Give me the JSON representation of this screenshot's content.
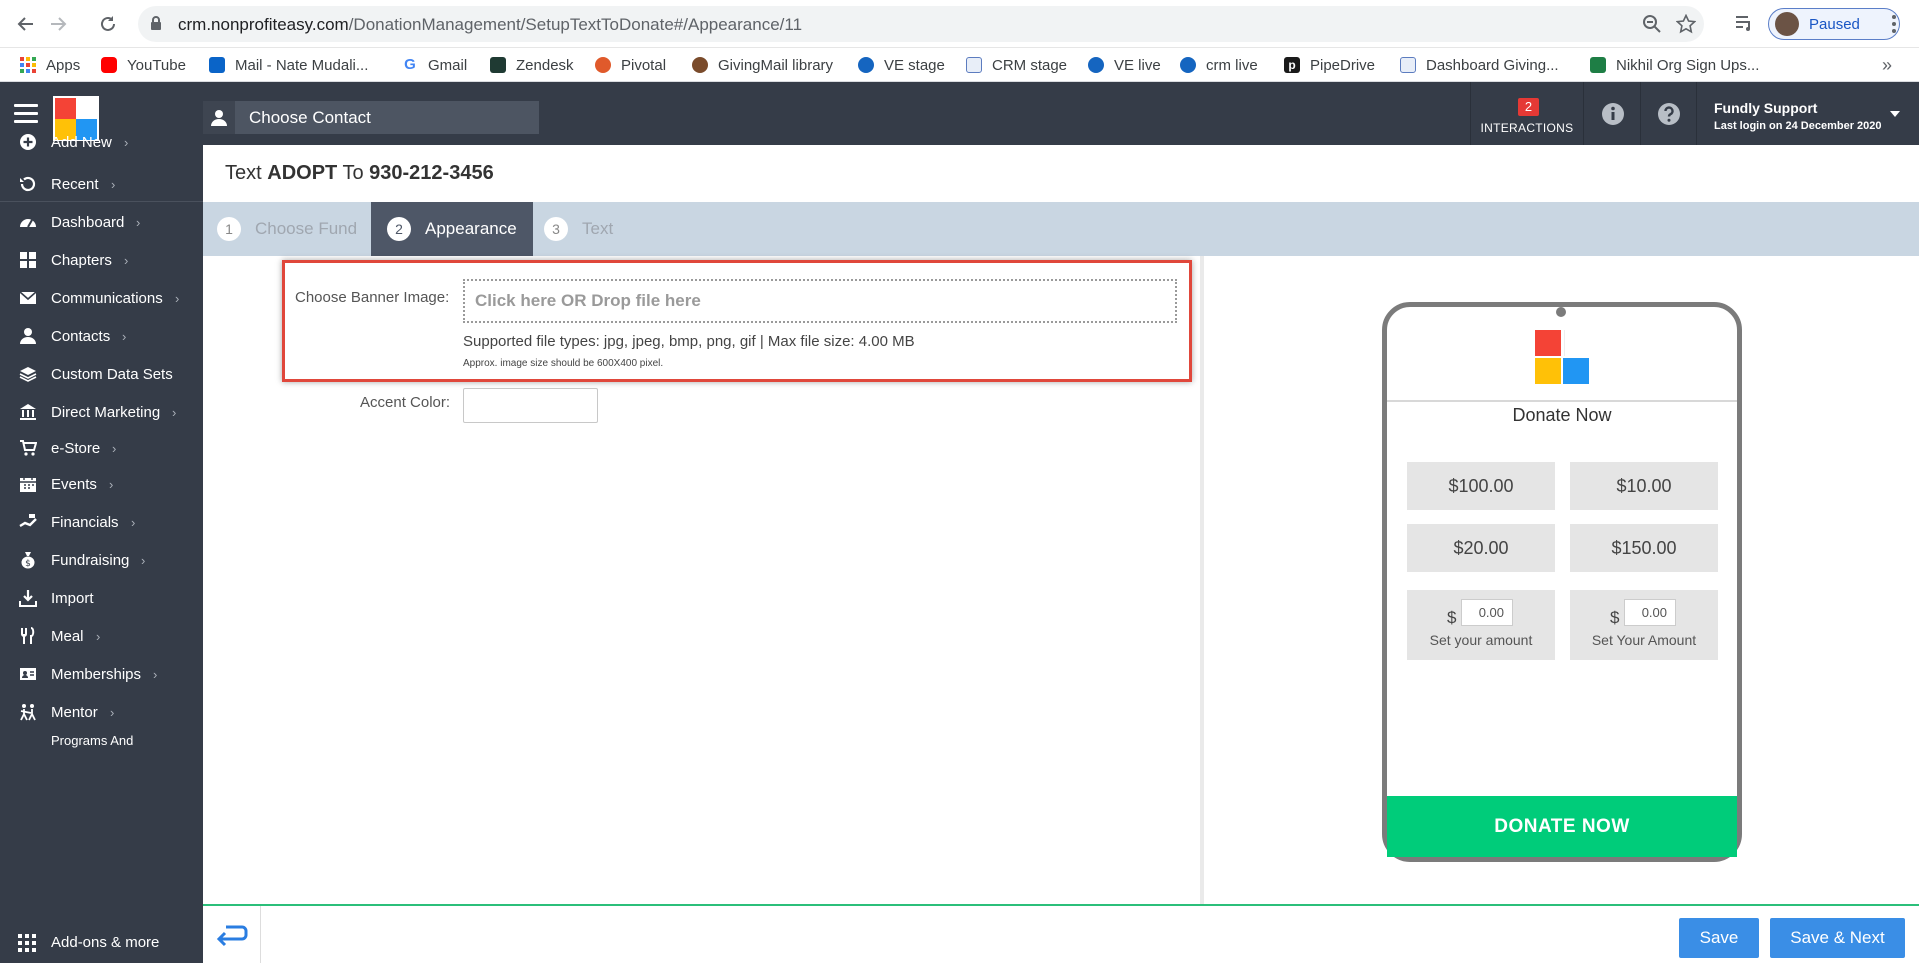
{
  "browser": {
    "url_host": "crm.nonprofiteasy.com",
    "url_path": "/DonationManagement/SetupTextToDonate#/Appearance/11",
    "profile_status": "Paused",
    "bookmarks": [
      {
        "label": "Apps",
        "color": "#4285f4"
      },
      {
        "label": "YouTube",
        "color": "#ff0000"
      },
      {
        "label": "Mail - Nate Mudali...",
        "color": "#0a64c8"
      },
      {
        "label": "Gmail",
        "color": "#ea4335"
      },
      {
        "label": "Zendesk",
        "color": "#1f3a33"
      },
      {
        "label": "Pivotal",
        "color": "#e05a2b"
      },
      {
        "label": "GivingMail library",
        "color": "#7a4b2b"
      },
      {
        "label": "VE stage",
        "color": "#1565c0"
      },
      {
        "label": "CRM stage",
        "color": "#5c7cbf"
      },
      {
        "label": "VE live",
        "color": "#1565c0"
      },
      {
        "label": "crm live",
        "color": "#1565c0"
      },
      {
        "label": "PipeDrive",
        "color": "#1a1a1a"
      },
      {
        "label": "Dashboard Giving...",
        "color": "#5c7cbf"
      },
      {
        "label": "Nikhil Org Sign Ups...",
        "color": "#1e7e45"
      }
    ],
    "more_bookmarks": "»"
  },
  "header": {
    "choose_contact": "Choose Contact",
    "interactions_count": "2",
    "interactions_label": "INTERACTIONS",
    "user_name": "Fundly Support",
    "last_login": "Last login on 24 December 2020"
  },
  "sidebar": {
    "items": [
      {
        "label": "Add New",
        "icon": "plus-circle-icon",
        "chevron": true
      },
      {
        "label": "Recent",
        "icon": "history-icon",
        "chevron": true
      },
      {
        "label": "Dashboard",
        "icon": "dashboard-icon",
        "chevron": true
      },
      {
        "label": "Chapters",
        "icon": "grid-icon",
        "chevron": true
      },
      {
        "label": "Communications",
        "icon": "envelope-icon",
        "chevron": true
      },
      {
        "label": "Contacts",
        "icon": "user-icon",
        "chevron": true
      },
      {
        "label": "Custom Data Sets",
        "icon": "layers-icon",
        "chevron": false
      },
      {
        "label": "Direct Marketing",
        "icon": "bank-icon",
        "chevron": true
      },
      {
        "label": "e-Store",
        "icon": "cart-icon",
        "chevron": true
      },
      {
        "label": "Events",
        "icon": "calendar-icon",
        "chevron": true
      },
      {
        "label": "Financials",
        "icon": "hand-money-icon",
        "chevron": true
      },
      {
        "label": "Fundraising",
        "icon": "money-bag-icon",
        "chevron": true
      },
      {
        "label": "Import",
        "icon": "import-icon",
        "chevron": false
      },
      {
        "label": "Meal",
        "icon": "utensils-icon",
        "chevron": true
      },
      {
        "label": "Memberships",
        "icon": "id-card-icon",
        "chevron": true
      },
      {
        "label": "Mentor",
        "icon": "mentor-icon",
        "chevron": true
      },
      {
        "label": "Programs And",
        "icon": "",
        "chevron": false
      }
    ],
    "addons": "Add-ons & more"
  },
  "page": {
    "title_prefix": "Text",
    "keyword": "ADOPT",
    "title_mid": "To",
    "phone_number": "930-212-3456"
  },
  "tabs": [
    {
      "num": "1",
      "label": "Choose Fund"
    },
    {
      "num": "2",
      "label": "Appearance"
    },
    {
      "num": "3",
      "label": "Text"
    }
  ],
  "form": {
    "banner_label": "Choose Banner Image:",
    "dropzone_text": "Click here OR Drop file here",
    "file_types": "Supported file types: jpg, jpeg, bmp, png, gif | Max file size: 4.00 MB",
    "size_hint": "Approx. image size should be 600X400 pixel.",
    "accent_label": "Accent Color:",
    "accent_value": ""
  },
  "preview": {
    "title": "Donate Now",
    "amounts": [
      "$100.00",
      "$10.00",
      "$20.00",
      "$150.00"
    ],
    "custom": [
      {
        "currency": "$",
        "value": "0.00",
        "label": "Set your amount"
      },
      {
        "currency": "$",
        "value": "0.00",
        "label": "Set Your Amount"
      }
    ],
    "donate_button": "DONATE NOW",
    "accent_color": "#00cc7a"
  },
  "footer": {
    "save": "Save",
    "save_next": "Save & Next"
  }
}
